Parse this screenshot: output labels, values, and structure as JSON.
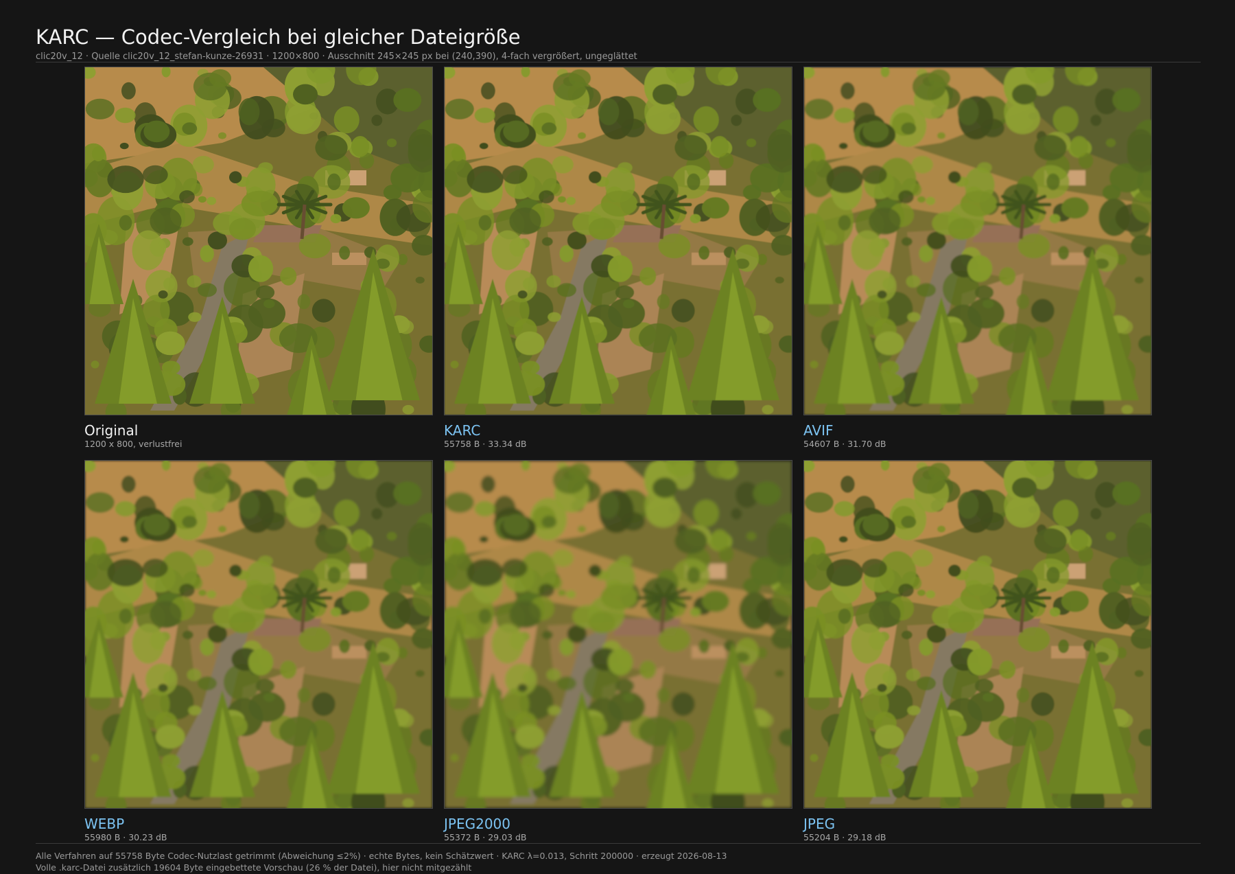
{
  "header": {
    "title": "KARC — Codec-Vergleich bei gleicher Dateigröße",
    "subtitle": "clic20v_12 · Quelle clic20v_12_stefan-kunze-26931 · 1200×800 · Ausschnitt 245×245 px bei (240,390), 4-fach vergrößert, ungeglättet"
  },
  "colors": {
    "background": "#151515",
    "accent_label": "#7cc3f2",
    "original_label": "#f2f2f2"
  },
  "panels": [
    {
      "name": "Original",
      "meta": "1200 x 800, verlustfrei",
      "accent": false,
      "blur": 0
    },
    {
      "name": "KARC",
      "meta": "55758 B · 33.34 dB",
      "accent": true,
      "blur": 0.6
    },
    {
      "name": "AVIF",
      "meta": "54607 B · 31.70 dB",
      "accent": true,
      "blur": 1.2
    },
    {
      "name": "WEBP",
      "meta": "55980 B · 30.23 dB",
      "accent": true,
      "blur": 1.6
    },
    {
      "name": "JPEG2000",
      "meta": "55372 B · 29.03 dB",
      "accent": true,
      "blur": 2.4
    },
    {
      "name": "JPEG",
      "meta": "55204 B · 29.18 dB",
      "accent": true,
      "blur": 1.0
    }
  ],
  "footer": {
    "line1": "Alle Verfahren auf 55758 Byte Codec-Nutzlast getrimmt (Abweichung ≤2%)  ·  echte Bytes, kein Schätzwert  ·  KARC λ=0.013, Schritt 200000  ·  erzeugt 2026-08-13",
    "line2": "Volle .karc-Datei zusätzlich 19604 Byte eingebettete Vorschau (26 % der Datei), hier nicht mitgezählt"
  }
}
